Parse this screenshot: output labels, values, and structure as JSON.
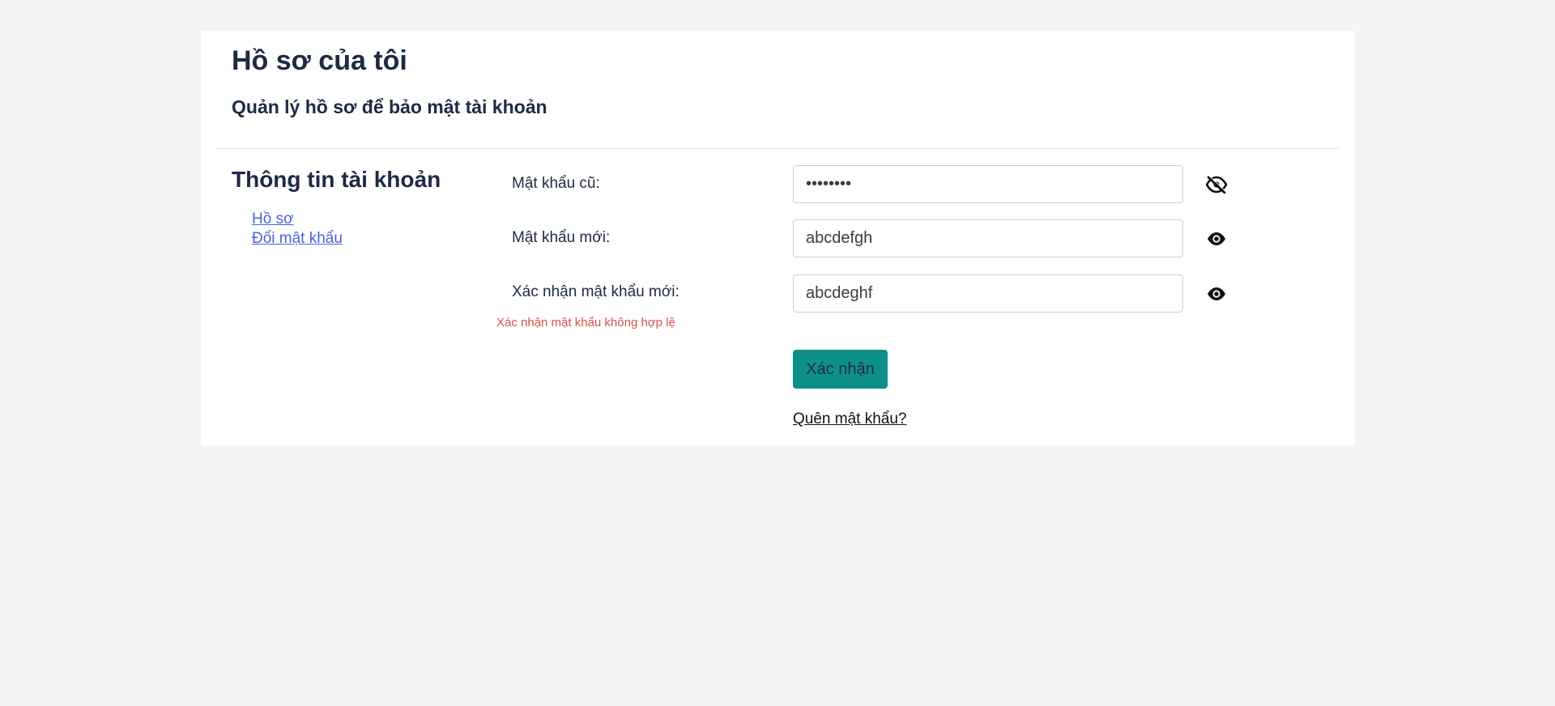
{
  "header": {
    "title": "Hồ sơ của tôi",
    "subtitle": "Quản lý hồ sơ để bảo mật tài khoản"
  },
  "sidebar": {
    "title": "Thông tin tài khoản",
    "links": [
      {
        "label": "Hồ sơ"
      },
      {
        "label": "Đổi mật khẩu"
      }
    ]
  },
  "form": {
    "old_password": {
      "label": "Mật khẩu cũ:",
      "value": "abcdefgh",
      "type": "password",
      "toggle_icon": "eye-slash-icon"
    },
    "new_password": {
      "label": "Mật khẩu mới:",
      "value": "abcdefgh",
      "type": "text",
      "toggle_icon": "eye-icon"
    },
    "confirm_password": {
      "label": "Xác nhận mật khẩu mới:",
      "value": "abcdeghf",
      "type": "text",
      "toggle_icon": "eye-icon"
    },
    "error_message": "Xác nhận mật khẩu không hợp lệ",
    "submit_label": "Xác nhận",
    "forgot_label": "Quên mật khẩu?"
  },
  "colors": {
    "page_background": "#f4f4f4",
    "card_background": "#ffffff",
    "heading_text": "#1e2a44",
    "link": "#4a62d8",
    "error": "#d0544a",
    "button_background": "#0e908a"
  }
}
